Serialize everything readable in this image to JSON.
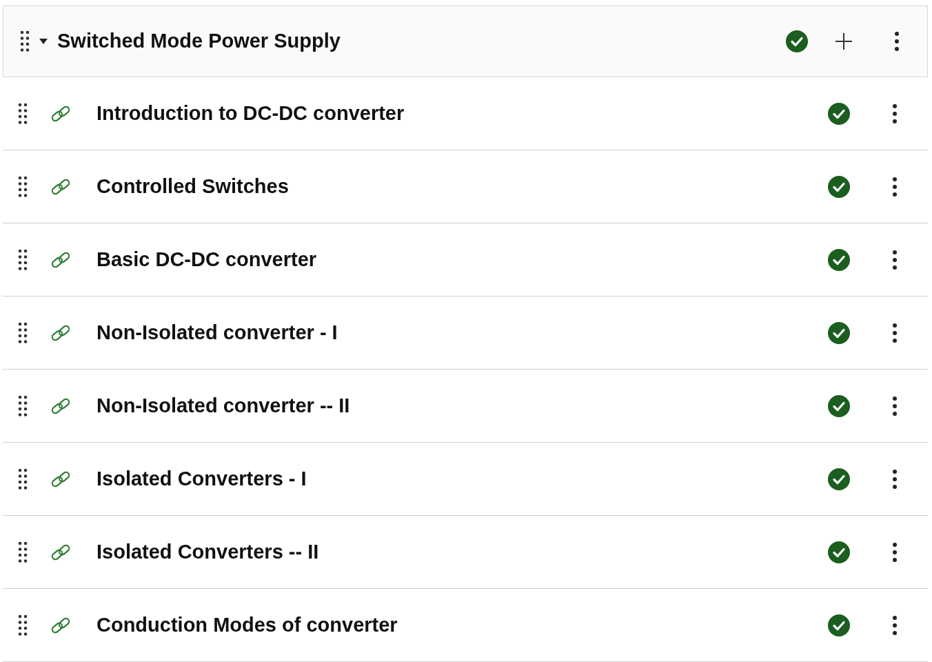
{
  "section": {
    "title": "Switched Mode Power Supply",
    "expanded": true,
    "complete": true
  },
  "lessons": [
    {
      "title": "Introduction to DC-DC converter",
      "complete": true
    },
    {
      "title": "Controlled Switches",
      "complete": true
    },
    {
      "title": "Basic DC-DC converter",
      "complete": true
    },
    {
      "title": "Non-Isolated converter - I",
      "complete": true
    },
    {
      "title": "Non-Isolated converter -- II",
      "complete": true
    },
    {
      "title": "Isolated Converters - I",
      "complete": true
    },
    {
      "title": "Isolated Converters -- II",
      "complete": true
    },
    {
      "title": "Conduction Modes of converter",
      "complete": true
    }
  ]
}
